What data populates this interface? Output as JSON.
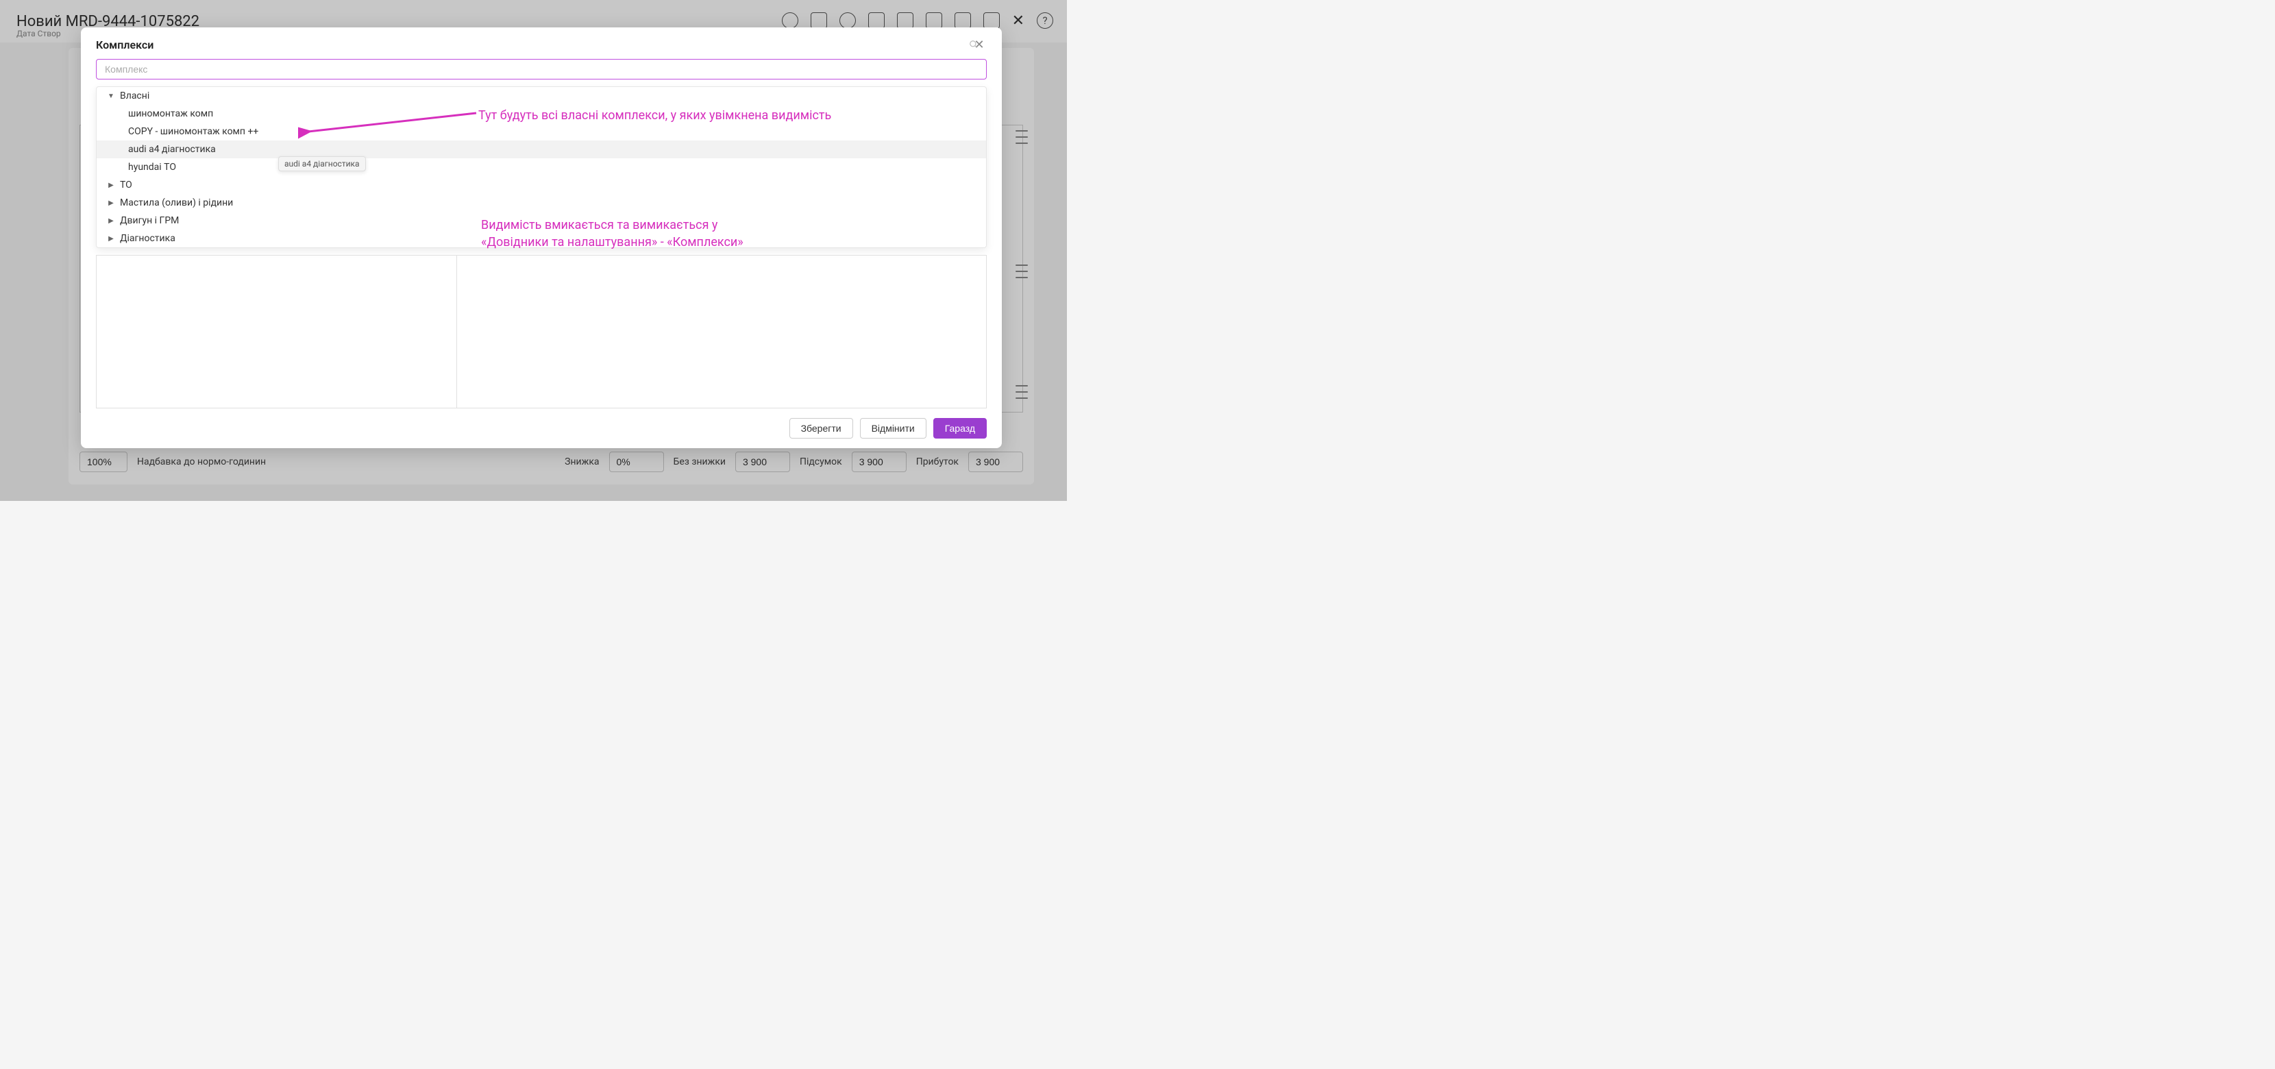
{
  "bg": {
    "title": "Новий MRD-9444-1075822",
    "subtitle": "Дата Створ",
    "footer": {
      "percent": "100%",
      "surcharge_label": "Надбавка до нормо-годинин",
      "discount_label": "Знижка",
      "discount_value": "0%",
      "no_discount_label": "Без знижки",
      "no_discount_value": "3 900",
      "subtotal_label": "Підсумок",
      "subtotal_value": "3 900",
      "profit_label": "Прибуток",
      "profit_value": "3 900"
    }
  },
  "modal": {
    "title": "Комплекси",
    "search_placeholder": "Комплекс",
    "tree": {
      "own": {
        "label": "Власні",
        "expanded": true,
        "items": [
          "шиномонтаж комп",
          "COPY - шиномонтаж комп ++",
          "audi a4 діагностика",
          "hyundai ТО"
        ]
      },
      "groups_collapsed": [
        "ТО",
        "Мастила (оливи) і рідини",
        "Двигун і ГРМ",
        "Діагностика"
      ]
    },
    "tooltip": "audi a4 діагностика",
    "buttons": {
      "save": "Зберегти",
      "cancel": "Відмінити",
      "ok": "Гаразд"
    }
  },
  "annotations": {
    "note1": "Тут будуть всі власні комплекси, у яких увімкнена видимість",
    "note2_line1": "Видимість вмикається та вимикається у",
    "note2_line2": "«Довідники та налаштування» - «Комплекси»"
  }
}
